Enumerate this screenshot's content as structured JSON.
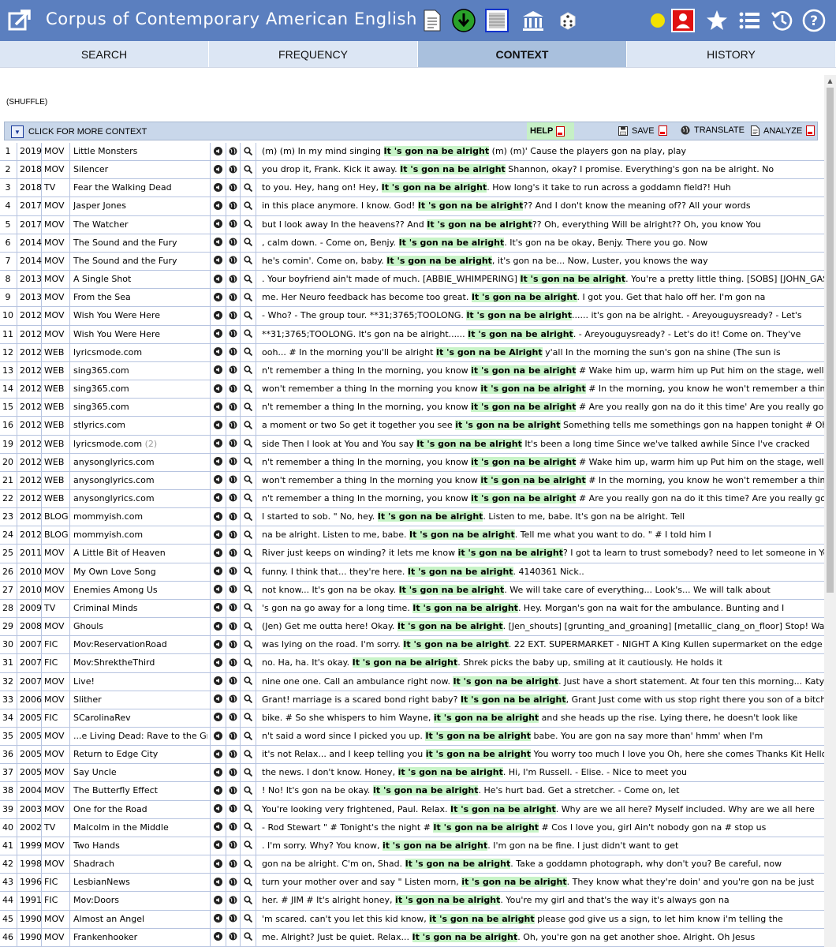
{
  "app": {
    "title": "Corpus of Contemporary American English"
  },
  "tabs": [
    {
      "label": "SEARCH",
      "active": false
    },
    {
      "label": "FREQUENCY",
      "active": false
    },
    {
      "label": "CONTEXT",
      "active": true
    },
    {
      "label": "HISTORY",
      "active": false
    }
  ],
  "toolbar_icons": [
    "document-icon",
    "download-icon",
    "texture-icon",
    "bank-icon",
    "dice-icon",
    "status-dot-icon",
    "user-icon",
    "star-icon",
    "list-icon",
    "history-icon",
    "help-icon"
  ],
  "colors": {
    "topbar": "#5b7fbf",
    "tab_bg": "#dce6f4",
    "tab_active": "#a9c0dd",
    "keyword_bg": "#c8f4c8",
    "help_bg": "#c6f0c6"
  },
  "controls": {
    "shuffle": "(SHUFFLE)",
    "more_context": "CLICK FOR MORE CONTEXT",
    "help": "HELP",
    "save": "SAVE",
    "translate": "TRANSLATE",
    "analyze": "ANALYZE"
  },
  "rows": [
    {
      "n": "1",
      "year": "2019",
      "genre": "MOV",
      "source": "Little Monsters",
      "pre": "(m) (m) In my mind singing ",
      "post": " (m) (m)' Cause the players gon na play, play"
    },
    {
      "n": "2",
      "year": "2018",
      "genre": "MOV",
      "source": "Silencer",
      "pre": "you drop it, Frank. Kick it away. ",
      "post": " Shannon, okay? I promise. Everything's gon na be alright. No"
    },
    {
      "n": "3",
      "year": "2018",
      "genre": "TV",
      "source": "Fear the Walking Dead",
      "pre": "to you. Hey, hang on! Hey, ",
      "post": ". How long's it take to run across a goddamn field?! Huh"
    },
    {
      "n": "4",
      "year": "2017",
      "genre": "MOV",
      "source": "Jasper Jones",
      "pre": "in this place anymore. I know. God! ",
      "post": "?? And I don't know the meaning of?? All your words"
    },
    {
      "n": "5",
      "year": "2017",
      "genre": "MOV",
      "source": "The Watcher",
      "pre": "but I look away In the heavens?? And ",
      "post": "?? Oh, everything Will be alright?? Oh, you know You"
    },
    {
      "n": "6",
      "year": "2014",
      "genre": "MOV",
      "source": "The Sound and the Fury",
      "pre": ", calm down. - Come on, Benjy. ",
      "post": ". It's gon na be okay, Benjy. There you go. Now"
    },
    {
      "n": "7",
      "year": "2014",
      "genre": "MOV",
      "source": "The Sound and the Fury",
      "pre": "he's comin'. Come on, baby. ",
      "post": ", it's gon na be... Now, Luster, you knows the way"
    },
    {
      "n": "8",
      "year": "2013",
      "genre": "MOV",
      "source": "A Single Shot",
      "pre": ". Your boyfriend ain't made of much. [ABBIE_WHIMPERING] ",
      "post": ". You're a pretty little thing. [SOBS] [JOHN_GASPING] [GASPING]"
    },
    {
      "n": "9",
      "year": "2013",
      "genre": "MOV",
      "source": "From the Sea",
      "pre": "me. Her Neuro feedback has become too great. ",
      "post": ". I got you. Get that halo off her. I'm gon na"
    },
    {
      "n": "10",
      "year": "2012",
      "genre": "MOV",
      "source": "Wish You Were Here",
      "pre": "- Who? - The group tour. **31;3765;TOOLONG. ",
      "post": "...... it's gon na be alright. - Areyouguysready? - Let's"
    },
    {
      "n": "11",
      "year": "2012",
      "genre": "MOV",
      "source": "Wish You Were Here",
      "pre": "**31;3765;TOOLONG. It's gon na be alright...... ",
      "post": ". - Areyouguysready? - Let's do it! Come on. They've"
    },
    {
      "n": "12",
      "year": "2012",
      "genre": "WEB",
      "source": "lyricsmode.com",
      "pre": "ooh... # In the morning you'll be alright ",
      "post": " y'all In the morning the sun's gon na shine (The sun is",
      "w": [
        "It",
        "'s",
        "gon",
        "na",
        "be",
        "Alright"
      ]
    },
    {
      "n": "13",
      "year": "2012",
      "genre": "WEB",
      "source": "sing365.com",
      "pre": "n't remember a thing In the morning, you know ",
      "post": " # Wake him up, warm him up Put him on the stage, well",
      "w": [
        "it",
        "'s",
        "gon",
        "na",
        "be",
        "alright"
      ]
    },
    {
      "n": "14",
      "year": "2012",
      "genre": "WEB",
      "source": "sing365.com",
      "pre": "won't remember a thing In the morning you know ",
      "post": " # In the morning, you know he won't remember a thing In the",
      "w": [
        "it",
        "'s",
        "gon",
        "na",
        "be",
        "alright"
      ]
    },
    {
      "n": "15",
      "year": "2012",
      "genre": "WEB",
      "source": "sing365.com",
      "pre": "n't remember a thing In the morning, you know ",
      "post": " # Are you really gon na do it this time' Are you really gon",
      "w": [
        "it",
        "'s",
        "gon",
        "na",
        "be",
        "alright"
      ]
    },
    {
      "n": "16",
      "year": "2012",
      "genre": "WEB",
      "source": "stlyrics.com",
      "pre": "a moment or two So get it together you see ",
      "post": " Something tells me somethings gon na happen tonight # Oh i woke up this m",
      "w": [
        "it",
        "'s",
        "gon",
        "na",
        "be",
        "alright"
      ]
    },
    {
      "n": "19",
      "year": "2012",
      "genre": "WEB",
      "source": "lyricsmode.com",
      "count": "(2)",
      "pre": "side Then I look at You and You say ",
      "post": " It's been a long time Since we've talked awhile Since I've cracked"
    },
    {
      "n": "20",
      "year": "2012",
      "genre": "WEB",
      "source": "anysonglyrics.com",
      "pre": "n't remember a thing In the morning, you know ",
      "post": " # Wake him up, warm him up Put him on the stage, well",
      "w": [
        "it",
        "'s",
        "gon",
        "na",
        "be",
        "alright"
      ]
    },
    {
      "n": "21",
      "year": "2012",
      "genre": "WEB",
      "source": "anysonglyrics.com",
      "pre": "won't remember a thing In the morning you know ",
      "post": " # In the morning, you know he won't remember a thing In the",
      "w": [
        "it",
        "'s",
        "gon",
        "na",
        "be",
        "alright"
      ]
    },
    {
      "n": "22",
      "year": "2012",
      "genre": "WEB",
      "source": "anysonglyrics.com",
      "pre": "n't remember a thing In the morning, you know ",
      "post": " # Are you really gon na do it this time? Are you really gon",
      "w": [
        "it",
        "'s",
        "gon",
        "na",
        "be",
        "alright"
      ]
    },
    {
      "n": "23",
      "year": "2012",
      "genre": "BLOG",
      "source": "mommyish.com",
      "pre": "I started to sob. \" No, hey. ",
      "post": ". Listen to me, babe. It's gon na be alright. Tell"
    },
    {
      "n": "24",
      "year": "2012",
      "genre": "BLOG",
      "source": "mommyish.com",
      "pre": "na be alright. Listen to me, babe. ",
      "post": ". Tell me what you want to do. \" # I told him I"
    },
    {
      "n": "25",
      "year": "2011",
      "genre": "MOV",
      "source": "A Little Bit of Heaven",
      "pre": "River just keeps on winding? it lets me know ",
      "post": "? I got ta learn to trust somebody? need to let someone in Yes",
      "w": [
        "it",
        "'s",
        "gon",
        "na",
        "be",
        "alright"
      ]
    },
    {
      "n": "26",
      "year": "2010",
      "genre": "MOV",
      "source": "My Own Love Song",
      "pre": "funny. I think that... they're here. ",
      "post": ". 4140361 Nick.."
    },
    {
      "n": "27",
      "year": "2010",
      "genre": "MOV",
      "source": "Enemies Among Us",
      "pre": "not know... It's gon na be okay. ",
      "post": ". We will take care of everything... Look's... We will talk about"
    },
    {
      "n": "28",
      "year": "2009",
      "genre": "TV",
      "source": "Criminal Minds",
      "pre": "'s gon na go away for a long time. ",
      "post": ". Hey. Morgan's gon na wait for the ambulance. Bunting and I"
    },
    {
      "n": "29",
      "year": "2008",
      "genre": "MOV",
      "source": "Ghouls",
      "pre": "(Jen) Get me outta here! Okay. ",
      "post": ". [Jen_shouts] [grunting_and_groaning] [metallic_clang_on_floor] Stop! Watch out! No! Thom"
    },
    {
      "n": "30",
      "year": "2007",
      "genre": "FIC",
      "source": "Mov:ReservationRoad",
      "pre": "was lying on the road. I'm sorry. ",
      "post": ". 22 EXT. SUPERMARKET - NIGHT A King Kullen supermarket on the edge of"
    },
    {
      "n": "31",
      "year": "2007",
      "genre": "FIC",
      "source": "Mov:ShrektheThird",
      "pre": "no. Ha, ha. It's okay. ",
      "post": ". Shrek picks the baby up, smiling at it cautiously. He holds it"
    },
    {
      "n": "32",
      "year": "2007",
      "genre": "MOV",
      "source": "Live!",
      "pre": "nine one one. Call an ambulance right now. ",
      "post": ". Just have a short statement. At four ten this morning... Katy Courbet"
    },
    {
      "n": "33",
      "year": "2006",
      "genre": "MOV",
      "source": "Slither",
      "pre": "Grant! marriage is a scared bond right baby? ",
      "post": ", Grant Just come with us stop right there you son of a bitch now"
    },
    {
      "n": "34",
      "year": "2005",
      "genre": "FIC",
      "source": "SCarolinaRev",
      "pre": "bike. # So she whispers to him Wayne, ",
      "post": " and she heads up the rise. Lying there, he doesn't look like",
      "w": [
        "it",
        "'s",
        "gon",
        "na",
        "be",
        "alright"
      ]
    },
    {
      "n": "35",
      "year": "2005",
      "genre": "MOV",
      "source": "...e Living Dead: Rave to the Grave",
      "pre": "n't said a word since I picked you up. ",
      "post": " babe. You are gon na say more than' hmm' when I'm"
    },
    {
      "n": "36",
      "year": "2005",
      "genre": "MOV",
      "source": "Return to Edge City",
      "pre": "it's not Relax... and I keep telling you ",
      "post": " You worry too much I love you Oh, here she comes Thanks Kit Hello",
      "w": [
        "it",
        "'s",
        "gon",
        "na",
        "be",
        "alright"
      ]
    },
    {
      "n": "37",
      "year": "2005",
      "genre": "MOV",
      "source": "Say Uncle",
      "pre": "the news. I don't know. Honey, ",
      "post": ". Hi, I'm Russell. - Elise. - Nice to meet you",
      "w": [
        "it",
        "'s",
        "gon",
        "na",
        "be",
        "alright"
      ]
    },
    {
      "n": "38",
      "year": "2004",
      "genre": "MOV",
      "source": "The Butterfly Effect",
      "pre": "! No! It's gon na be okay. ",
      "post": ". He's hurt bad. Get a stretcher. - Come on, let"
    },
    {
      "n": "39",
      "year": "2003",
      "genre": "MOV",
      "source": "One for the Road",
      "pre": "You're looking very frightened, Paul. Relax. ",
      "post": ". Why are we all here? Myself included. Why are we all here"
    },
    {
      "n": "40",
      "year": "2002",
      "genre": "TV",
      "source": "Malcolm in the Middle",
      "pre": "- Rod Stewart \" # Tonight's the night # ",
      "post": " # Cos I love you, girl Ain't nobody gon na # stop us"
    },
    {
      "n": "41",
      "year": "1999",
      "genre": "MOV",
      "source": "Two Hands",
      "pre": ". I'm sorry. Why? You know, ",
      "post": ". I'm gon na be fine. I just didn't want to get",
      "w": [
        "it",
        "'s",
        "gon",
        "na",
        "be",
        "alright"
      ]
    },
    {
      "n": "42",
      "year": "1998",
      "genre": "MOV",
      "source": "Shadrach",
      "pre": "gon na be alright. C'm on, Shad. ",
      "post": ". Take a goddamn photograph, why don't you? Be careful, now"
    },
    {
      "n": "43",
      "year": "1996",
      "genre": "FIC",
      "source": "LesbianNews",
      "pre": "turn your mother over and say \" Listen morn, ",
      "post": ". They know what they're doin' and you're gon na be just",
      "w": [
        "it",
        "'s",
        "gon",
        "na",
        "be",
        "alright"
      ]
    },
    {
      "n": "44",
      "year": "1991",
      "genre": "FIC",
      "source": "Mov:Doors",
      "pre": "her. # JIM # It's alright honey, ",
      "post": ". You're my girl and that's the way it's always gon na",
      "w": [
        "it",
        "'s",
        "gon",
        "na",
        "be",
        "alright"
      ]
    },
    {
      "n": "45",
      "year": "1990",
      "genre": "MOV",
      "source": "Almost an Angel",
      "pre": "'m scared. can't you let this kid know, ",
      "post": " please god give us a sign, to let him know i'm telling the",
      "w": [
        "it",
        "'s",
        "gon",
        "na",
        "be",
        "alright"
      ]
    },
    {
      "n": "46",
      "year": "1990",
      "genre": "MOV",
      "source": "Frankenhooker",
      "pre": "me. Alright? Just be quiet. Relax... ",
      "post": ". Oh, you're gon na get another shoe. Alright. Oh Jesus"
    }
  ],
  "keyword_default": [
    "It",
    "'s",
    "gon",
    "na",
    "be",
    "alright"
  ]
}
